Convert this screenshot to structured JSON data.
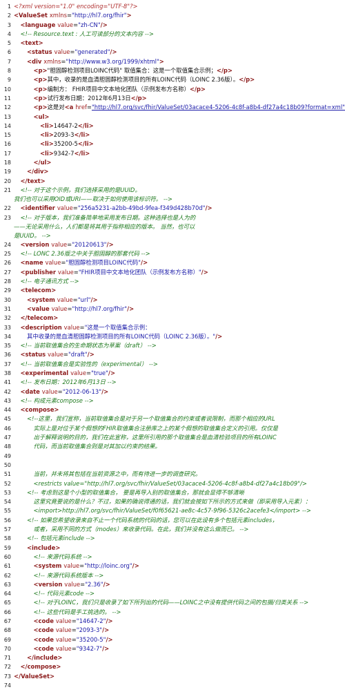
{
  "lines": [
    {
      "n": "1",
      "indent": 0,
      "tokens": [
        [
          "pi",
          "<?xml version=\"1.0\" encoding=\"UTF-8\"?>"
        ]
      ]
    },
    {
      "n": "2",
      "indent": 0,
      "tokens": [
        [
          "el",
          "<ValueSet "
        ],
        [
          "at",
          "xmlns"
        ],
        [
          "pl",
          "="
        ],
        [
          "val",
          "\"http://hl7.org/fhir\""
        ],
        [
          "el",
          ">"
        ]
      ]
    },
    {
      "n": "3",
      "indent": 1,
      "tokens": [
        [
          "el",
          "<language "
        ],
        [
          "at",
          "value"
        ],
        [
          "pl",
          "="
        ],
        [
          "val",
          "\"zh-CN\""
        ],
        [
          "el",
          "/>"
        ]
      ]
    },
    {
      "n": "4",
      "indent": 1,
      "tokens": [
        [
          "cm",
          "<!--  Resource.text : 人工可读部分的文本内容  -->"
        ]
      ]
    },
    {
      "n": "5",
      "indent": 1,
      "tokens": [
        [
          "el",
          "<text>"
        ]
      ]
    },
    {
      "n": "6",
      "indent": 2,
      "tokens": [
        [
          "el",
          "<status "
        ],
        [
          "at",
          "value"
        ],
        [
          "pl",
          "="
        ],
        [
          "val",
          "\"generated\""
        ],
        [
          "el",
          "/>"
        ]
      ]
    },
    {
      "n": "7",
      "indent": 2,
      "tokens": [
        [
          "el",
          "<div "
        ],
        [
          "at",
          "xmlns"
        ],
        [
          "pl",
          "="
        ],
        [
          "val",
          "\"http://www.w3.org/1999/xhtml\""
        ],
        [
          "el",
          ">"
        ]
      ]
    },
    {
      "n": "8",
      "indent": 3,
      "tokens": [
        [
          "el",
          "<p>"
        ],
        [
          "pl",
          "\"胆固醇检测项目LOINC代码\" 取值集合：这是一个取值集合示例；"
        ],
        [
          "el",
          "</p>"
        ]
      ]
    },
    {
      "n": "9",
      "indent": 3,
      "tokens": [
        [
          "el",
          "<p>"
        ],
        [
          "pl",
          "其中，收录的是血清胆固醇检测项目的所有LOINC代码（LOINC 2.36版）。"
        ],
        [
          "el",
          "</p>"
        ]
      ]
    },
    {
      "n": "10",
      "indent": 3,
      "tokens": [
        [
          "el",
          "<p>"
        ],
        [
          "pl",
          "编制方： FHIR项目中文本地化团队（示例发布方名称）"
        ],
        [
          "el",
          "</p>"
        ]
      ]
    },
    {
      "n": "11",
      "indent": 3,
      "tokens": [
        [
          "el",
          "<p>"
        ],
        [
          "pl",
          "试行发布日期：2012年6月13日"
        ],
        [
          "el",
          "</p>"
        ]
      ]
    },
    {
      "n": "12",
      "indent": 3,
      "tokens": [
        [
          "el",
          "<p>"
        ],
        [
          "pl",
          "这是对"
        ],
        [
          "el",
          "<a "
        ],
        [
          "at",
          "href"
        ],
        [
          "pl",
          "="
        ],
        [
          "ln",
          "\"http://hl7.org/svc/fhir/ValueSet/03acace4-5206-4c8f-a8b4-df27a4c18b09?format=xml\""
        ],
        [
          "el",
          ">"
        ]
      ]
    },
    {
      "n": "13",
      "indent": 3,
      "tokens": [
        [
          "el",
          "<ul>"
        ]
      ]
    },
    {
      "n": "14",
      "indent": 4,
      "tokens": [
        [
          "el",
          "<li>"
        ],
        [
          "pl",
          "14647-2"
        ],
        [
          "el",
          "</li>"
        ]
      ]
    },
    {
      "n": "15",
      "indent": 4,
      "tokens": [
        [
          "el",
          "<li>"
        ],
        [
          "pl",
          "2093-3"
        ],
        [
          "el",
          "</li>"
        ]
      ]
    },
    {
      "n": "16",
      "indent": 4,
      "tokens": [
        [
          "el",
          "<li>"
        ],
        [
          "pl",
          "35200-5"
        ],
        [
          "el",
          "</li>"
        ]
      ]
    },
    {
      "n": "17",
      "indent": 4,
      "tokens": [
        [
          "el",
          "<li>"
        ],
        [
          "pl",
          "9342-7"
        ],
        [
          "el",
          "</li>"
        ]
      ]
    },
    {
      "n": "18",
      "indent": 3,
      "tokens": [
        [
          "el",
          "</ul>"
        ]
      ]
    },
    {
      "n": "19",
      "indent": 2,
      "tokens": [
        [
          "el",
          "</div>"
        ]
      ]
    },
    {
      "n": "20",
      "indent": 1,
      "tokens": [
        [
          "el",
          "</text>"
        ]
      ]
    },
    {
      "n": "21",
      "indent": 1,
      "tokens": [
        [
          "cm",
          "<!--  对于这个示例，我们选择采用的是UUID。"
        ]
      ]
    },
    {
      "n": "",
      "indent": 0,
      "tokens": [
        [
          "cm",
          "我们也可以采用OID或URI——取决于如何使用该标识符。   -->"
        ]
      ]
    },
    {
      "n": "22",
      "indent": 1,
      "tokens": [
        [
          "el",
          "<identifier "
        ],
        [
          "at",
          "value"
        ],
        [
          "pl",
          "="
        ],
        [
          "val",
          "\"256a5231-a2bb-49bd-9fea-f349d428b70d\""
        ],
        [
          "el",
          "/>"
        ]
      ]
    },
    {
      "n": "23",
      "indent": 1,
      "tokens": [
        [
          "cm",
          "<!--  对于版本，我们准备简单地采用发布日期。这种选择也是人为的"
        ]
      ]
    },
    {
      "n": "",
      "indent": 0,
      "tokens": [
        [
          "cm",
          "——无论采用什么，人们都是将其用于指称相应的版本。  当然，也可以"
        ]
      ]
    },
    {
      "n": "",
      "indent": 0,
      "tokens": [
        [
          "cm",
          "是UUID。   -->"
        ]
      ]
    },
    {
      "n": "24",
      "indent": 1,
      "tokens": [
        [
          "el",
          "<version "
        ],
        [
          "at",
          "value"
        ],
        [
          "pl",
          "="
        ],
        [
          "val",
          "\"20120613\""
        ],
        [
          "el",
          "/>"
        ]
      ]
    },
    {
      "n": "25",
      "indent": 1,
      "tokens": [
        [
          "cm",
          "<!--  LONC 2.36版之中关于胆固醇的那套代码  -->"
        ]
      ]
    },
    {
      "n": "26",
      "indent": 1,
      "tokens": [
        [
          "el",
          "<name "
        ],
        [
          "at",
          "value"
        ],
        [
          "pl",
          "="
        ],
        [
          "val",
          "\"胆固醇检测项目LOINC代码\""
        ],
        [
          "el",
          "/>"
        ]
      ]
    },
    {
      "n": "27",
      "indent": 1,
      "tokens": [
        [
          "el",
          "<publisher "
        ],
        [
          "at",
          "value"
        ],
        [
          "pl",
          "="
        ],
        [
          "val",
          "\"FHIR项目中文本地化团队（示例发布方名称）\""
        ],
        [
          "el",
          "/>"
        ]
      ]
    },
    {
      "n": "28",
      "indent": 1,
      "tokens": [
        [
          "cm",
          "<!--  电子通讯方式  -->"
        ]
      ]
    },
    {
      "n": "29",
      "indent": 1,
      "tokens": [
        [
          "el",
          "<telecom>"
        ]
      ]
    },
    {
      "n": "30",
      "indent": 2,
      "tokens": [
        [
          "el",
          "<system "
        ],
        [
          "at",
          "value"
        ],
        [
          "pl",
          "="
        ],
        [
          "val",
          "\"url\""
        ],
        [
          "el",
          "/>"
        ]
      ]
    },
    {
      "n": "31",
      "indent": 2,
      "tokens": [
        [
          "el",
          "<value "
        ],
        [
          "at",
          "value"
        ],
        [
          "pl",
          "="
        ],
        [
          "val",
          "\"http://hl7.org/fhir\""
        ],
        [
          "el",
          "/>"
        ]
      ]
    },
    {
      "n": "32",
      "indent": 1,
      "tokens": [
        [
          "el",
          "</telecom>"
        ]
      ]
    },
    {
      "n": "33",
      "indent": 1,
      "tokens": [
        [
          "el",
          "<description "
        ],
        [
          "at",
          "value"
        ],
        [
          "pl",
          "="
        ],
        [
          "val",
          "\"这是一个取值集合示例："
        ]
      ]
    },
    {
      "n": "34",
      "indent": 2,
      "tokens": [
        [
          "val",
          "其中收录的是血清胆固醇检测项目的所有LOINC代码（LOINC 2.36版）。\""
        ],
        [
          "el",
          "/>"
        ]
      ]
    },
    {
      "n": "35",
      "indent": 1,
      "tokens": [
        [
          "cm",
          "<!--  当前取值集合的生命期状态为草案（draft）  -->"
        ]
      ]
    },
    {
      "n": "36",
      "indent": 1,
      "tokens": [
        [
          "el",
          "<status "
        ],
        [
          "at",
          "value"
        ],
        [
          "pl",
          "="
        ],
        [
          "val",
          "\"draft\""
        ],
        [
          "el",
          "/>"
        ]
      ]
    },
    {
      "n": "37",
      "indent": 1,
      "tokens": [
        [
          "cm",
          "<!--  当前取值集合是实验性的（experimental）  -->"
        ]
      ]
    },
    {
      "n": "38",
      "indent": 1,
      "tokens": [
        [
          "el",
          "<experimental "
        ],
        [
          "at",
          "value"
        ],
        [
          "pl",
          "="
        ],
        [
          "val",
          "\"true\""
        ],
        [
          "el",
          "/>"
        ]
      ]
    },
    {
      "n": "41",
      "indent": 1,
      "tokens": [
        [
          "cm",
          "<!--  发布日期：2012年6月13日  -->"
        ]
      ]
    },
    {
      "n": "42",
      "indent": 1,
      "tokens": [
        [
          "el",
          "<date "
        ],
        [
          "at",
          "value"
        ],
        [
          "pl",
          "="
        ],
        [
          "val",
          "\"2012-06-13\""
        ],
        [
          "el",
          "/>"
        ]
      ]
    },
    {
      "n": "43",
      "indent": 1,
      "tokens": [
        [
          "cm",
          "<!--  构成元素compose  -->"
        ]
      ]
    },
    {
      "n": "44",
      "indent": 1,
      "tokens": [
        [
          "el",
          "<compose>"
        ]
      ]
    },
    {
      "n": "45",
      "indent": 2,
      "tokens": [
        [
          "cm",
          "<!--这里，我们宣称，当前取值集合是对于另一个取值集合的约束或者说限制，而那个相应的URL"
        ]
      ]
    },
    {
      "n": "46",
      "indent": 3,
      "tokens": [
        [
          "cm",
          "实际上是对位于某个假想的FHIR取值集合注册库之上的某个假想的取值集合定义的引用。仅仅是"
        ]
      ]
    },
    {
      "n": "47",
      "indent": 3,
      "tokens": [
        [
          "cm",
          "出于解释说明的目的，我们在此宣称，这里所引用的那个取值集合是血清检验项目的所有LOINC"
        ]
      ]
    },
    {
      "n": "48",
      "indent": 3,
      "tokens": [
        [
          "cm",
          "代码，而当前取值集合则是对其加以约束的结果。"
        ]
      ]
    },
    {
      "n": "49",
      "indent": 0,
      "tokens": []
    },
    {
      "n": "50",
      "indent": 0,
      "tokens": []
    },
    {
      "n": "51",
      "indent": 3,
      "tokens": [
        [
          "cm",
          "当前，并未将其包括在当前资源之中，而有待进一步的调查研究。"
        ]
      ]
    },
    {
      "n": "52",
      "indent": 3,
      "tokens": [
        [
          "cm",
          "<restricts value=\"http://hl7.org/svc/fhir/ValueSet/03acace4-5206-4c8f-a8b4-df27a4c18b09\"/>"
        ]
      ]
    },
    {
      "n": "53",
      "indent": 2,
      "tokens": [
        [
          "cm",
          "<!--  考虑到这是个小型的取值集合， 要是再导入别的取值集合，那就会显得不够清晰"
        ]
      ]
    },
    {
      "n": "54",
      "indent": 3,
      "tokens": [
        [
          "cm",
          "这里究竟要说的是什么？不过，如果的确说得通的话，我们就会按如下所示的方式来做（即采用导入元素）："
        ]
      ]
    },
    {
      "n": "55",
      "indent": 3,
      "tokens": [
        [
          "cm",
          "<import>http://hl7.org/svc/fhir/ValueSet/f0f65621-ae8c-4c57-9f96-5326c2acefe3</import>   -->"
        ]
      ]
    },
    {
      "n": "56",
      "indent": 2,
      "tokens": [
        [
          "cm",
          "<!--  如果您希望收录来自不止一个代码系统的代码的话，您可以在此设有多个包括元素includes，"
        ]
      ]
    },
    {
      "n": "57",
      "indent": 3,
      "tokens": [
        [
          "cm",
          "或者，采用不同的方式（modes）来收录代码。在此，我们并没有这么做而已。   -->"
        ]
      ]
    },
    {
      "n": "58",
      "indent": 2,
      "tokens": [
        [
          "cm",
          "<!--  包括元素include  -->"
        ]
      ]
    },
    {
      "n": "59",
      "indent": 2,
      "tokens": [
        [
          "el",
          "<include>"
        ]
      ]
    },
    {
      "n": "60",
      "indent": 3,
      "tokens": [
        [
          "cm",
          "<!--  来源代码系统  -->"
        ]
      ]
    },
    {
      "n": "61",
      "indent": 3,
      "tokens": [
        [
          "el",
          "<system "
        ],
        [
          "at",
          "value"
        ],
        [
          "pl",
          "="
        ],
        [
          "val",
          "\"http://loinc.org\""
        ],
        [
          "el",
          "/>"
        ]
      ]
    },
    {
      "n": "62",
      "indent": 3,
      "tokens": [
        [
          "cm",
          "<!--  来源代码系统版本  -->"
        ]
      ]
    },
    {
      "n": "63",
      "indent": 3,
      "tokens": [
        [
          "el",
          "<version "
        ],
        [
          "at",
          "value"
        ],
        [
          "pl",
          "="
        ],
        [
          "val",
          "\"2.36\""
        ],
        [
          "el",
          "/>"
        ]
      ]
    },
    {
      "n": "64",
      "indent": 3,
      "tokens": [
        [
          "cm",
          "<!--  代码元素code  -->"
        ]
      ]
    },
    {
      "n": "65",
      "indent": 3,
      "tokens": [
        [
          "cm",
          "<!--  对于LOINC，我们只是收录了如下所列出的代码——LOINC之中没有提供代码之间的包摄/归类关系  -->"
        ]
      ]
    },
    {
      "n": "66",
      "indent": 3,
      "tokens": [
        [
          "cm",
          "<!--  这些代码是手工挑选的。   -->"
        ]
      ]
    },
    {
      "n": "67",
      "indent": 3,
      "tokens": [
        [
          "el",
          "<code "
        ],
        [
          "at",
          "value"
        ],
        [
          "pl",
          "="
        ],
        [
          "val",
          "\"14647-2\""
        ],
        [
          "el",
          "/>"
        ]
      ]
    },
    {
      "n": "68",
      "indent": 3,
      "tokens": [
        [
          "el",
          "<code "
        ],
        [
          "at",
          "value"
        ],
        [
          "pl",
          "="
        ],
        [
          "val",
          "\"2093-3\""
        ],
        [
          "el",
          "/>"
        ]
      ]
    },
    {
      "n": "69",
      "indent": 3,
      "tokens": [
        [
          "el",
          "<code "
        ],
        [
          "at",
          "value"
        ],
        [
          "pl",
          "="
        ],
        [
          "val",
          "\"35200-5\""
        ],
        [
          "el",
          "/>"
        ]
      ]
    },
    {
      "n": "70",
      "indent": 3,
      "tokens": [
        [
          "el",
          "<code "
        ],
        [
          "at",
          "value"
        ],
        [
          "pl",
          "="
        ],
        [
          "val",
          "\"9342-7\""
        ],
        [
          "el",
          "/>"
        ]
      ]
    },
    {
      "n": "71",
      "indent": 2,
      "tokens": [
        [
          "el",
          "</include>"
        ]
      ]
    },
    {
      "n": "72",
      "indent": 1,
      "tokens": [
        [
          "el",
          "</compose>"
        ]
      ]
    },
    {
      "n": "73",
      "indent": 0,
      "tokens": [
        [
          "el",
          "</ValueSet>"
        ]
      ]
    },
    {
      "n": "74",
      "indent": 0,
      "tokens": []
    }
  ]
}
